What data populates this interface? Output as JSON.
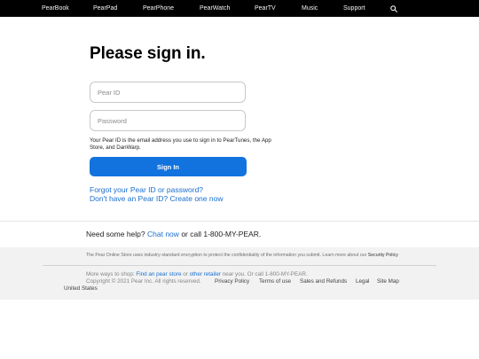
{
  "nav": {
    "items": [
      "PearBook",
      "PearPad",
      "PearPhone",
      "PearWatch",
      "PearTV",
      "Music",
      "Support"
    ],
    "search_icon": "search-icon"
  },
  "signin": {
    "title": "Please sign in.",
    "pear_id_placeholder": "Pear ID",
    "password_placeholder": "Password",
    "help_text": "Your Pear ID is the email address you use to sign in to PearTunes, the App Store, and DanWarp.",
    "button_label": "Sign In",
    "forgot_link": "Forgot your Pear ID or password?",
    "create_link": "Don't have an Pear ID? Create one now"
  },
  "help_bar": {
    "prefix": "Need some help?",
    "chat_link": "Chat now",
    "suffix": "or call 1-800-MY-PEAR."
  },
  "footer": {
    "encryption_text": "The Pear Online Store uses industry-standard encryption to protect the confidentiality of the information you submit. Learn more about our",
    "security_link": "Security Policy",
    "shop_prefix": "More ways to shop:",
    "find_store_link": "Find an pear store",
    "shop_or": "or",
    "retailer_link": "other retailer",
    "shop_suffix": "near you. Or call 1-800-MY-PEAR.",
    "copyright": "Copyright © 2021 Pear Inc. All rights reserved.",
    "links": [
      "Privacy Policy",
      "Terms of use",
      "Sales and Refunds",
      "Legal",
      "Site Map"
    ],
    "region": "United States"
  },
  "colors": {
    "nav_bg": "#000000",
    "primary_button": "#1273de",
    "link": "#1a6fcf",
    "footer_bg": "#f2f2f2"
  }
}
